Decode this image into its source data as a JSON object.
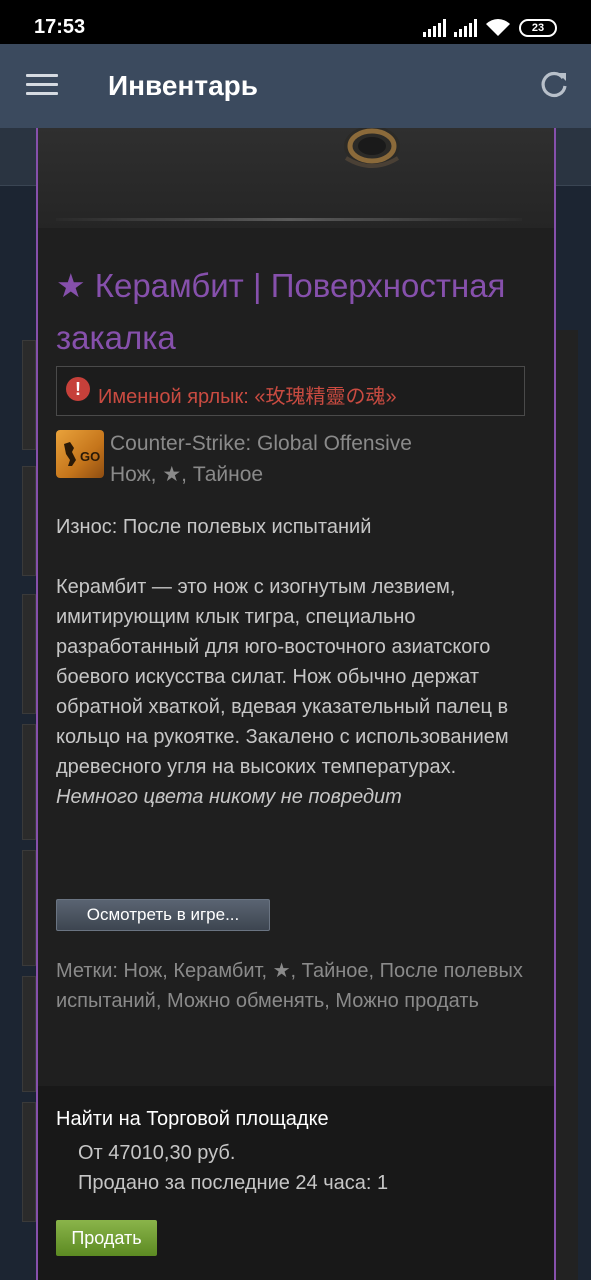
{
  "status_bar": {
    "time": "17:53",
    "battery": "23"
  },
  "header": {
    "title": "Инвентарь",
    "menu_icon": "hamburger-menu-icon",
    "refresh_icon": "refresh-icon"
  },
  "item": {
    "name": "★ Керамбит | Поверхностная закалка",
    "name_color": "#8650ac",
    "nametag": "Именной ярлык: «玫瑰精靈の魂»",
    "nametag_color": "#c94b41",
    "game": "Counter-Strike: Global Offensive",
    "type": "Нож, ★, Тайное",
    "wear": "Износ: После полевых испытаний",
    "description": "Керамбит — это нож с изогнутым лезвием, имитирующим клык тигра, специально разработанный для юго-восточного азиатского боевого искусства силат. Нож обычно держат обратной хваткой, вдевая указательный палец в кольцо на рукоятке. Закалено с использованием древесного угля на высоких температурах.",
    "description_italic": "Немного цвета никому не повредит",
    "inspect_label": "Осмотреть в игре...",
    "tags": "Метки: Нож, Керамбит, ★, Тайное, После полевых испытаний, Можно обменять, Можно продать"
  },
  "market": {
    "title": "Найти на Торговой площадке",
    "price": "От 47010,30 руб.",
    "sold": "Продано за последние 24 часа: 1",
    "sell_label": "Продать",
    "sell_color": "#6fa030"
  }
}
